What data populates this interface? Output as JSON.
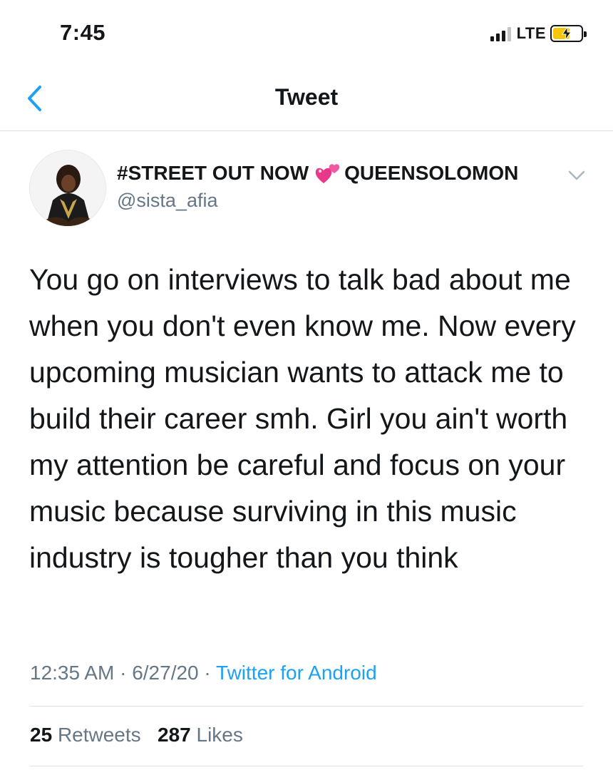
{
  "status_bar": {
    "time": "7:45",
    "network": "LTE",
    "signal_bars_active": 3,
    "battery_color": "#f6c60c",
    "battery_charging": true
  },
  "nav": {
    "title": "Tweet",
    "back_icon": "chevron-left-icon",
    "accent_color": "#1da1f2"
  },
  "tweet": {
    "author": {
      "name_part1": "#STREET OUT NOW",
      "name_emoji": "two-hearts-icon",
      "name_part2": "QUEENSOLOMON",
      "handle": "@sista_afia",
      "avatar": "profile-photo"
    },
    "text": "You go on interviews to talk bad about me when you don't even know me. Now every upcoming musician wants to attack me to build their career smh. Girl you ain't worth my attention be careful and focus on your music because surviving in this music industry is tougher than you think",
    "time": "12:35 AM",
    "date": "6/27/20",
    "separator": "·",
    "source": "Twitter for Android",
    "stats": {
      "retweets_count": "25",
      "retweets_label": "Retweets",
      "likes_count": "287",
      "likes_label": "Likes"
    }
  }
}
